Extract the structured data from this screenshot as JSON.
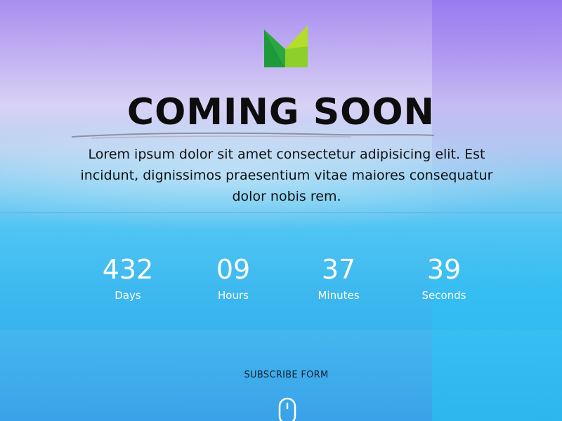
{
  "logo": {
    "icon": "logo-icon",
    "colors": {
      "dark_green": "#1e9a3a",
      "light_green": "#a8d82a"
    }
  },
  "hero": {
    "title": "COMING SOON",
    "description": "Lorem ipsum dolor sit amet consectetur adipisicing elit. Est incidunt, dignissimos praesentium vitae maiores consequatur dolor nobis rem."
  },
  "countdown": [
    {
      "value": "432",
      "label": "Days"
    },
    {
      "value": "09",
      "label": "Hours"
    },
    {
      "value": "37",
      "label": "Minutes"
    },
    {
      "value": "39",
      "label": "Seconds"
    }
  ],
  "subscribe": {
    "label": "SUBSCRIBE FORM"
  },
  "scroll_indicator": {
    "icon": "mouse-scroll-icon"
  },
  "colors": {
    "title": "#0d0d0d",
    "countdown_text": "#ffffff",
    "background_top": "#a88ef0",
    "background_bottom": "#38b2ee"
  }
}
